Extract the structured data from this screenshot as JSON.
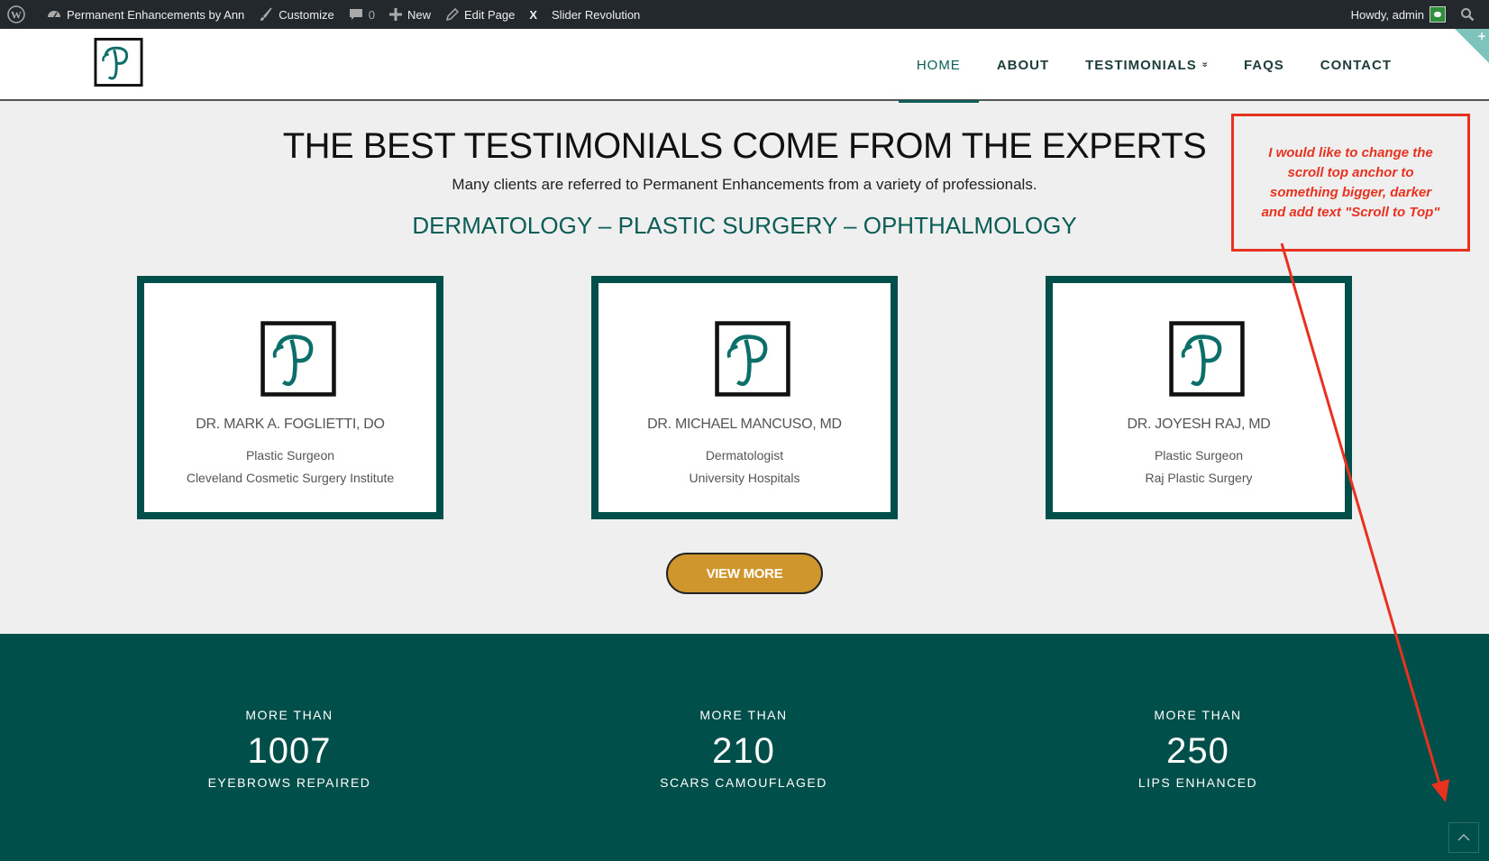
{
  "admin_bar": {
    "site_name": "Permanent Enhancements by Ann",
    "customize": "Customize",
    "comments_count": "0",
    "new": "New",
    "edit_page": "Edit Page",
    "slider_x": "X",
    "slider_revolution": "Slider Revolution",
    "howdy": "Howdy, admin"
  },
  "nav": {
    "items": [
      {
        "label": "HOME"
      },
      {
        "label": "ABOUT"
      },
      {
        "label": "TESTIMONIALS"
      },
      {
        "label": "FAQS"
      },
      {
        "label": "CONTACT"
      }
    ],
    "chevron": "»"
  },
  "hero": {
    "title": "THE BEST TESTIMONIALS COME FROM THE EXPERTS",
    "subtitle": "Many clients are referred to Permanent Enhancements from a variety of professionals.",
    "categories": "DERMATOLOGY – PLASTIC SURGERY – OPHTHALMOLOGY"
  },
  "cards": [
    {
      "name": "DR. MARK A. FOGLIETTI, DO",
      "role": "Plastic Surgeon",
      "org": "Cleveland Cosmetic Surgery Institute"
    },
    {
      "name": "DR. MICHAEL MANCUSO, MD",
      "role": "Dermatologist",
      "org": "University Hospitals"
    },
    {
      "name": "DR. JOYESH RAJ, MD",
      "role": "Plastic Surgeon",
      "org": "Raj Plastic Surgery"
    }
  ],
  "view_more": "VIEW MORE",
  "stats": [
    {
      "prefix": "MORE THAN",
      "number": "1007",
      "label": "EYEBROWS REPAIRED"
    },
    {
      "prefix": "MORE THAN",
      "number": "210",
      "label": "SCARS CAMOUFLAGED"
    },
    {
      "prefix": "MORE THAN",
      "number": "250",
      "label": "LIPS ENHANCED"
    }
  ],
  "annotation": "I would like to change the scroll top anchor to something bigger, darker and add text \"Scroll to Top\"",
  "colors": {
    "brand_teal": "#004f4a",
    "accent_gold": "#d0962e",
    "annotation_red": "#e8321f"
  },
  "icons": [
    "wordpress-icon",
    "dashboard-icon",
    "brush-icon",
    "comment-icon",
    "plus-icon",
    "pencil-icon",
    "search-icon",
    "chevron-up-icon"
  ]
}
